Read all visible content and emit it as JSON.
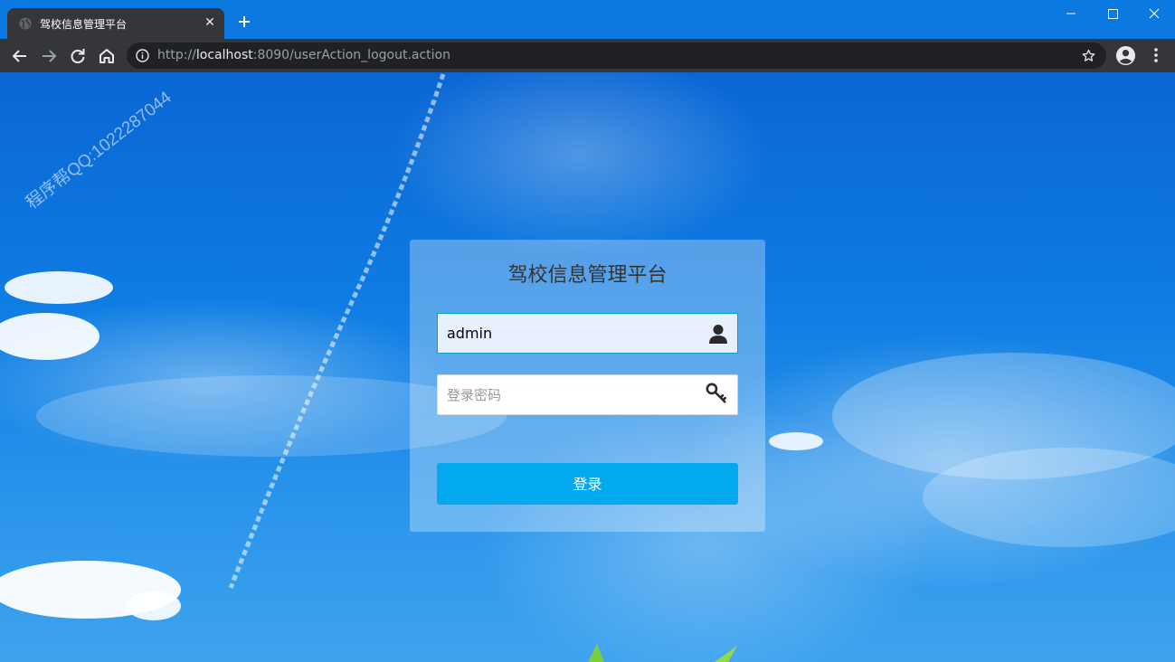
{
  "browser": {
    "tab_title": "驾校信息管理平台",
    "tab_close_glyph": "✕",
    "url_prefix": "http://",
    "url_host": "localhost",
    "url_path": ":8090/userAction_logout.action",
    "icons": [
      "globe-icon",
      "plus-icon",
      "minimize-icon",
      "maximize-icon",
      "close-icon",
      "back-arrow-icon",
      "forward-arrow-icon",
      "reload-icon",
      "home-icon",
      "info-icon",
      "star-icon",
      "profile-icon",
      "menu-dots-icon"
    ]
  },
  "page": {
    "watermark": "程序帮QQ:1022287044",
    "login": {
      "title": "驾校信息管理平台",
      "username_value": "admin",
      "password_placeholder": "登录密码",
      "submit_label": "登录",
      "accent_color": "#03a9ef",
      "icons": [
        "user-icon",
        "key-icon"
      ]
    }
  }
}
